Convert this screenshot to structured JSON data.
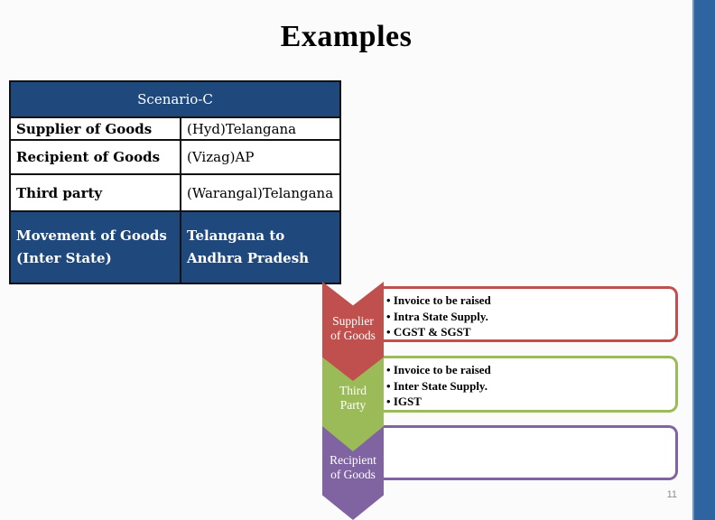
{
  "slide": {
    "title": "Examples",
    "page_number": "11",
    "accent_bar_color": "#2e64a0"
  },
  "table": {
    "header": "Scenario-C",
    "rows": [
      {
        "label": "Supplier of Goods",
        "value": "(Hyd)Telangana"
      },
      {
        "label": "Recipient of Goods",
        "value": "(Vizag)AP"
      },
      {
        "label": "Third party",
        "value": "(Warangal)Telangana"
      },
      {
        "label_line1": "Movement of Goods",
        "label_line2": "(Inter State)",
        "value_line1": "Telangana to",
        "value_line2": "Andhra Pradesh"
      }
    ]
  },
  "process": [
    {
      "label_line1": "Supplier",
      "label_line2": "of Goods",
      "color": "#c0504d",
      "bullets": [
        "Invoice to be raised",
        "Intra State Supply.",
        "CGST & SGST"
      ]
    },
    {
      "label_line1": "Third",
      "label_line2": "Party",
      "color": "#9bbb59",
      "bullets": [
        "Invoice to be raised",
        "Inter State Supply.",
        "IGST"
      ]
    },
    {
      "label_line1": "Recipient",
      "label_line2": "of Goods",
      "color": "#8064a2",
      "bullets": []
    }
  ]
}
